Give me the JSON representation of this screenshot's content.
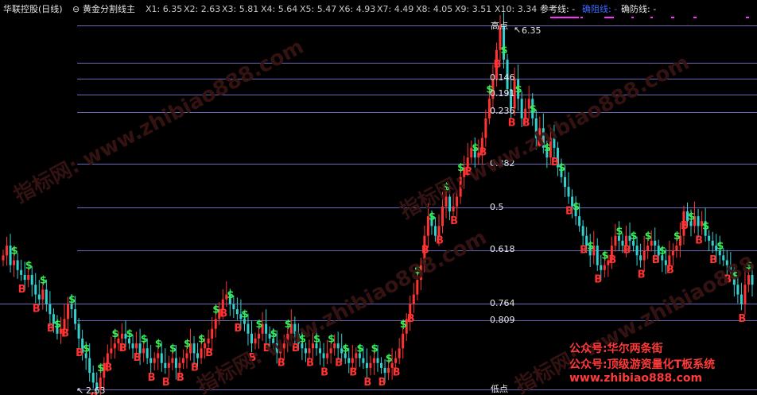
{
  "header": {
    "title": "华联控股(日线)",
    "indicator_name": "黄金分割线主",
    "legend": [
      {
        "label": "X1: 6.35",
        "color": "#c8c8c8"
      },
      {
        "label": "X2: 2.63",
        "color": "#c8c8c8"
      },
      {
        "label": "X3: 5.81",
        "color": "#c8c8c8"
      },
      {
        "label": "X4: 5.64",
        "color": "#c8c8c8"
      },
      {
        "label": "X5: 5.47",
        "color": "#c8c8c8"
      },
      {
        "label": "X6: 4.93",
        "color": "#c8c8c8"
      },
      {
        "label": "X7: 4.49",
        "color": "#c8c8c8"
      },
      {
        "label": "X8: 4.05",
        "color": "#c8c8c8"
      },
      {
        "label": "X9: 3.51",
        "color": "#c8c8c8"
      },
      {
        "label": "X10: 3.34",
        "color": "#c8c8c8"
      },
      {
        "label": "参考线: -",
        "color": "#e6e6e6"
      },
      {
        "label": "确阻线: -",
        "color": "#3a6bff"
      },
      {
        "label": "确防线: -",
        "color": "#e6e6e6"
      }
    ]
  },
  "levels": {
    "high_label": "高点",
    "high_value": "6.35",
    "low_label": "低点",
    "low_value": "2.63",
    "fib_labels": [
      "0.146",
      "0.191",
      "0.236",
      "0.382",
      "0.5",
      "0.618",
      "0.764",
      "0.809"
    ]
  },
  "watermark": {
    "text1": "指标网: www.zhibiao888.com"
  },
  "promo": {
    "line1": "公众号:华尔两条街",
    "line2": "公众号:顶级游资量化T板系统",
    "line3": "www.zhibiao888.com"
  },
  "signals": {
    "buy": "B",
    "sell": "$"
  },
  "colors": {
    "background": "#000000",
    "up": "#ff3333",
    "down": "#33d0d0",
    "buy_label": "#ff3333",
    "sell_label": "#33ee55",
    "fib_line": "#6a6ab8",
    "promo_text": "#ff3a3a",
    "magenta": "#ff33ff"
  },
  "chart_data": {
    "type": "candlestick",
    "ylim": [
      2.63,
      6.35
    ],
    "close": [
      4.0,
      4.1,
      3.9,
      3.95,
      3.85,
      3.8,
      3.75,
      3.8,
      3.7,
      3.6,
      3.55,
      3.65,
      3.5,
      3.4,
      3.3,
      3.2,
      3.25,
      3.35,
      3.5,
      3.45,
      3.3,
      3.15,
      3.0,
      2.95,
      2.8,
      2.7,
      2.63,
      2.75,
      2.9,
      3.0,
      3.05,
      3.1,
      3.15,
      3.2,
      3.15,
      3.1,
      3.05,
      3.1,
      3.0,
      3.05,
      2.95,
      2.9,
      2.95,
      3.0,
      2.9,
      2.85,
      2.9,
      2.95,
      2.85,
      2.9,
      2.95,
      3.0,
      3.1,
      3.0,
      2.95,
      3.05,
      3.1,
      3.15,
      3.25,
      3.35,
      3.45,
      3.55,
      3.6,
      3.5,
      3.45,
      3.4,
      3.35,
      3.3,
      3.2,
      3.1,
      3.15,
      3.2,
      3.3,
      3.2,
      3.15,
      3.1,
      3.0,
      3.05,
      3.1,
      3.2,
      3.3,
      3.2,
      3.1,
      3.05,
      3.0,
      3.05,
      3.1,
      3.05,
      3.0,
      2.95,
      3.0,
      3.05,
      3.1,
      3.05,
      3.0,
      2.95,
      2.9,
      2.95,
      3.0,
      2.95,
      2.9,
      2.85,
      2.9,
      2.95,
      2.9,
      2.85,
      2.8,
      2.85,
      2.9,
      2.95,
      3.05,
      3.2,
      3.35,
      3.5,
      3.6,
      3.75,
      3.9,
      4.2,
      4.4,
      4.3,
      4.2,
      4.3,
      4.5,
      4.6,
      4.45,
      4.5,
      4.6,
      4.8,
      4.9,
      5.0,
      5.1,
      5.0,
      5.05,
      5.2,
      5.4,
      5.6,
      5.8,
      6.1,
      6.35,
      6.0,
      5.7,
      5.5,
      5.8,
      5.6,
      5.4,
      5.5,
      5.6,
      5.4,
      5.2,
      5.3,
      5.1,
      5.0,
      5.2,
      5.1,
      4.9,
      4.8,
      4.7,
      4.6,
      4.5,
      4.4,
      4.3,
      4.2,
      4.1,
      4.0,
      4.1,
      3.9,
      3.85,
      3.9,
      3.95,
      4.1,
      4.2,
      4.15,
      4.1,
      4.2,
      4.15,
      4.1,
      4.0,
      3.95,
      4.05,
      4.1,
      4.15,
      4.1,
      4.0,
      3.95,
      3.9,
      4.0,
      4.05,
      4.1,
      4.2,
      4.45,
      4.35,
      4.3,
      4.4,
      4.3,
      4.35,
      4.2,
      4.15,
      4.1,
      4.05,
      4.0,
      3.95,
      3.9,
      3.85,
      3.7,
      3.6,
      3.5,
      3.7,
      3.8,
      3.7
    ]
  }
}
